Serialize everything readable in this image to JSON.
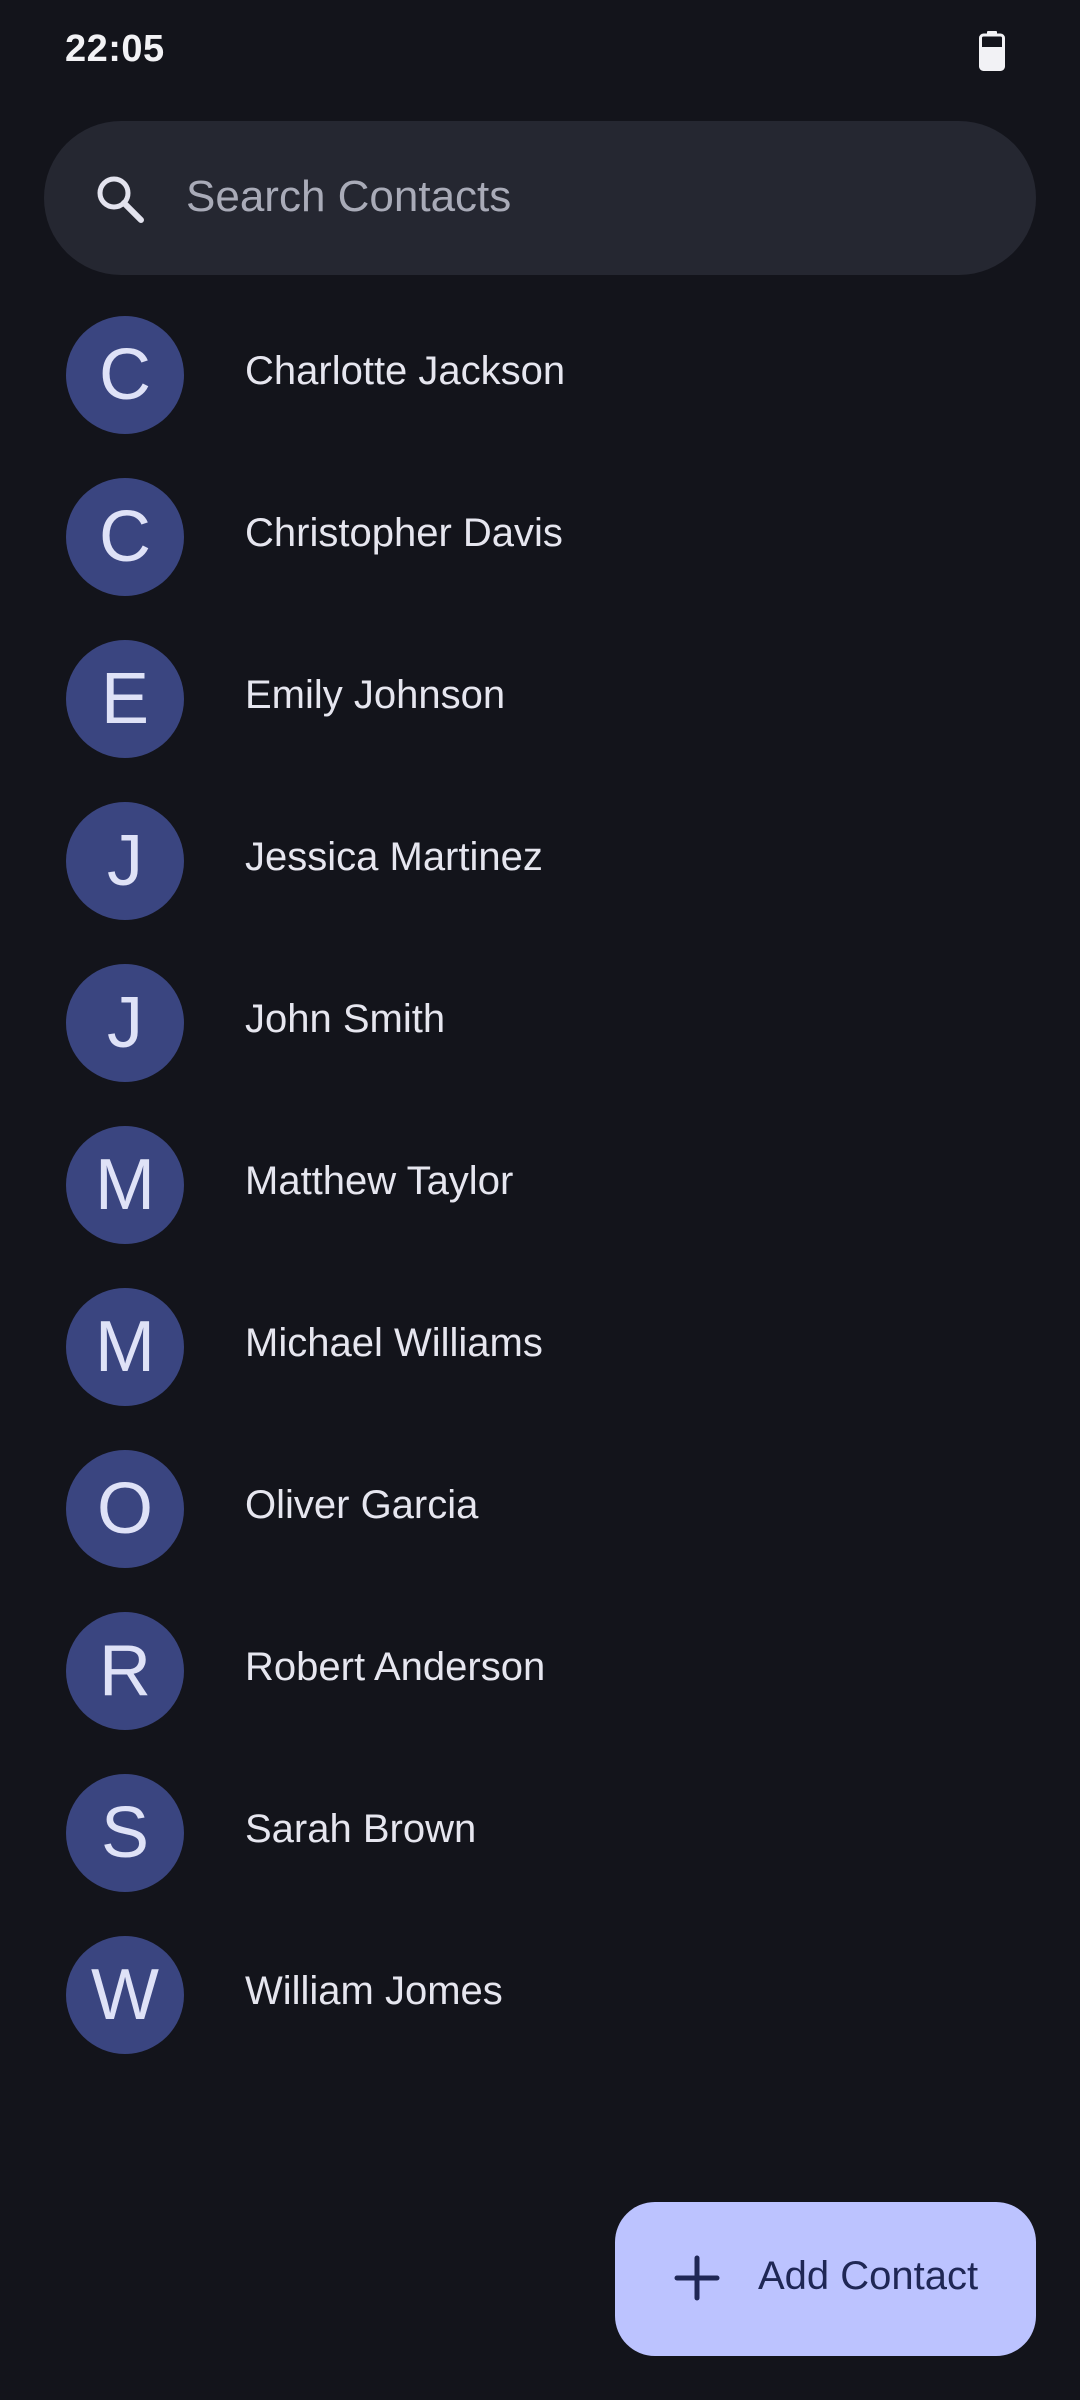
{
  "status_bar": {
    "time": "22:05",
    "battery_icon": "battery-icon"
  },
  "search": {
    "placeholder": "Search Contacts",
    "value": "",
    "icon": "search-icon"
  },
  "contacts": [
    {
      "initial": "C",
      "name": "Charlotte Jackson"
    },
    {
      "initial": "C",
      "name": "Christopher Davis"
    },
    {
      "initial": "E",
      "name": "Emily Johnson"
    },
    {
      "initial": "J",
      "name": "Jessica Martinez"
    },
    {
      "initial": "J",
      "name": "John Smith"
    },
    {
      "initial": "M",
      "name": "Matthew Taylor"
    },
    {
      "initial": "M",
      "name": "Michael Williams"
    },
    {
      "initial": "O",
      "name": "Oliver Garcia"
    },
    {
      "initial": "R",
      "name": "Robert Anderson"
    },
    {
      "initial": "S",
      "name": "Sarah Brown"
    },
    {
      "initial": "W",
      "name": "William Jomes"
    }
  ],
  "fab": {
    "label": "Add Contact",
    "icon": "plus-icon"
  },
  "colors": {
    "background": "#13141b",
    "search_bar": "#252731",
    "avatar": "#3a4580",
    "fab": "#bcc3ff",
    "fab_text": "#1f2755"
  }
}
